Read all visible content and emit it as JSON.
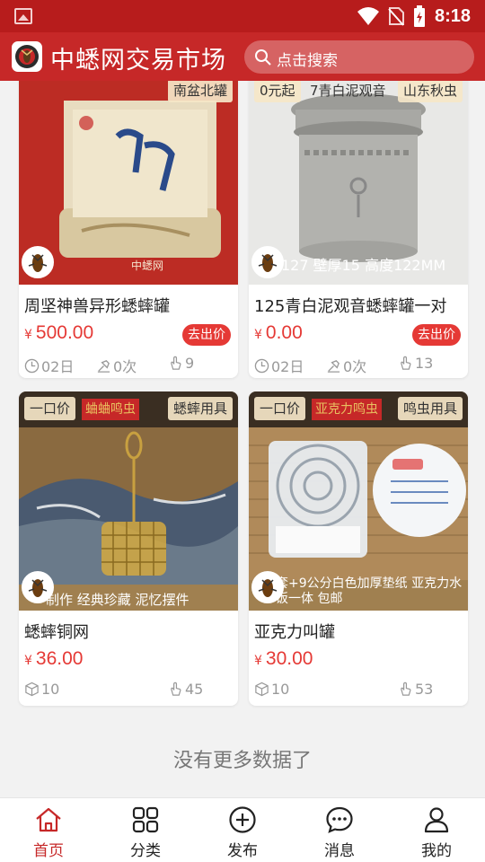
{
  "status_bar": {
    "time": "8:18"
  },
  "app": {
    "title": "中蟋网交易市场",
    "search_placeholder": "点击搜索"
  },
  "colors": {
    "brand": "#c62828",
    "price": "#e53935",
    "muted": "#999999"
  },
  "products": [
    {
      "tag_left": "",
      "tag_right": "南盆北罐",
      "image_caption": "中蟋网",
      "title": "周坚神兽异形蟋蟀罐",
      "currency": "¥",
      "price": "500.00",
      "bid_label": "去出价",
      "meta": [
        {
          "icon": "clock-icon",
          "value": "02日"
        },
        {
          "icon": "hammer-icon",
          "value": "0次"
        },
        {
          "icon": "hand-pointer-icon",
          "value": "9"
        }
      ]
    },
    {
      "tag_left": "0元起",
      "tag_center": "7青白泥观音",
      "tag_right": "山东秋虫",
      "image_caption": "127 壁厚15 高度122MM",
      "title": "125青白泥观音蟋蟀罐一对",
      "currency": "¥",
      "price": "0.00",
      "bid_label": "去出价",
      "meta": [
        {
          "icon": "clock-icon",
          "value": "02日"
        },
        {
          "icon": "hammer-icon",
          "value": "0次"
        },
        {
          "icon": "hand-pointer-icon",
          "value": "13"
        }
      ]
    },
    {
      "tag_left": "一口价",
      "tag_center": "蛐蛐鸣虫",
      "tag_right": "蟋蟀用具",
      "image_caption": "制作 经典珍藏 泥忆摆件",
      "title": "蟋蟀铜网",
      "currency": "¥",
      "price": "36.00",
      "meta": [
        {
          "icon": "box-icon",
          "value": "10"
        },
        {
          "icon": "hand-pointer-icon",
          "value": "45"
        }
      ]
    },
    {
      "tag_left": "一口价",
      "tag_center": "亚克力鸣虫",
      "tag_right": "鸣虫用具",
      "image_caption": "套+9公分白色加厚垫纸 亚克力水饭一体 包邮",
      "title": "亚克力叫罐",
      "currency": "¥",
      "price": "30.00",
      "meta": [
        {
          "icon": "box-icon",
          "value": "10"
        },
        {
          "icon": "hand-pointer-icon",
          "value": "53"
        }
      ]
    }
  ],
  "footer_text": "没有更多数据了",
  "tabs": [
    {
      "label": "首页",
      "icon": "home-icon",
      "active": true
    },
    {
      "label": "分类",
      "icon": "grid-icon",
      "active": false
    },
    {
      "label": "发布",
      "icon": "plus-circle-icon",
      "active": false
    },
    {
      "label": "消息",
      "icon": "chat-icon",
      "active": false
    },
    {
      "label": "我的",
      "icon": "user-icon",
      "active": false
    }
  ]
}
